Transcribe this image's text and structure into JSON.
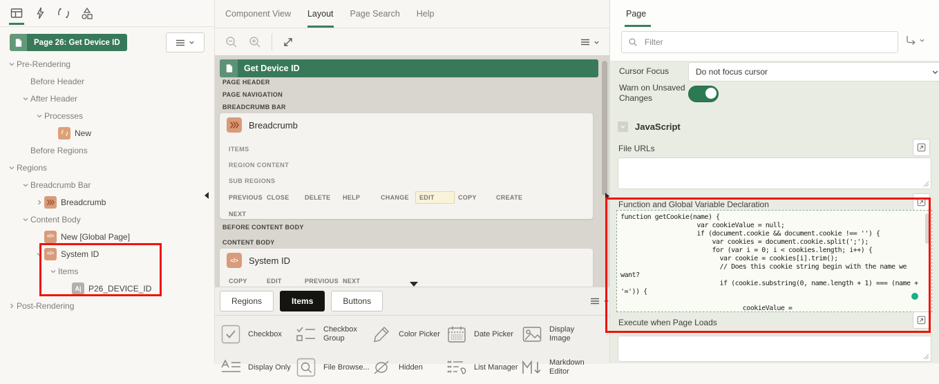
{
  "colors": {
    "green": "#38795a",
    "orange_icon": "#d99b7a",
    "annotation_red": "#ee1409",
    "toggle_on_green": "#2c7a52",
    "status_dot_green": "#19b183"
  },
  "left": {
    "toolbar_icons": [
      "rendering",
      "dynamic-actions",
      "processing",
      "shared-components"
    ],
    "toolbar_selected": "rendering",
    "page_badge": "Page 26: Get Device ID",
    "tree": [
      {
        "label": "Pre-Rendering",
        "level": 0,
        "chevron": "down"
      },
      {
        "label": "Before Header",
        "level": 1
      },
      {
        "label": "After Header",
        "level": 1,
        "chevron": "down"
      },
      {
        "label": "Processes",
        "level": 2,
        "chevron": "down"
      },
      {
        "label": "New",
        "level": 3,
        "icon": "process"
      },
      {
        "label": "Before Regions",
        "level": 1
      },
      {
        "label": "Regions",
        "level": 0,
        "chevron": "down"
      },
      {
        "label": "Breadcrumb Bar",
        "level": 1,
        "chevron": "down"
      },
      {
        "label": "Breadcrumb",
        "level": 2,
        "chevron": "right",
        "icon": "breadcrumb"
      },
      {
        "label": "Content Body",
        "level": 1,
        "chevron": "down"
      },
      {
        "label": "New [Global Page]",
        "level": 2,
        "icon": "code"
      },
      {
        "label": "System ID",
        "level": 2,
        "chevron": "down",
        "icon": "code"
      },
      {
        "label": "Items",
        "level": 3,
        "chevron": "down"
      },
      {
        "label": "P26_DEVICE_ID",
        "level": 4,
        "icon": "text-item"
      },
      {
        "label": "Post-Rendering",
        "level": 0,
        "chevron": "right"
      }
    ]
  },
  "center": {
    "tabs": [
      {
        "label": "Component View"
      },
      {
        "label": "Layout",
        "active": true
      },
      {
        "label": "Page Search"
      },
      {
        "label": "Help"
      }
    ],
    "canvas": {
      "page_title": "Get Device ID",
      "top_slots": [
        "PAGE HEADER",
        "PAGE NAVIGATION",
        "BREADCRUMB BAR"
      ],
      "breadcrumb_region": {
        "title": "Breadcrumb",
        "slots": [
          "ITEMS",
          "REGION CONTENT",
          "SUB REGIONS"
        ],
        "actions_row1": [
          "PREVIOUS",
          "CLOSE",
          "DELETE",
          "HELP",
          "CHANGE",
          "EDIT",
          "COPY",
          "CREATE"
        ],
        "actions_row2": [
          "NEXT"
        ],
        "highlighted_action": "EDIT"
      },
      "mid_slots": [
        "BEFORE CONTENT BODY",
        "CONTENT BODY"
      ],
      "system_region": {
        "title": "System ID",
        "actions_row1": [
          "COPY",
          "EDIT",
          "PREVIOUS",
          "NEXT"
        ],
        "actions_row2": []
      }
    },
    "gallery": {
      "tabs": [
        {
          "label": "Regions"
        },
        {
          "label": "Items",
          "active": true
        },
        {
          "label": "Buttons"
        }
      ],
      "row1": [
        {
          "icon": "checkbox",
          "label": "Checkbox",
          "two_line": false
        },
        {
          "icon": "checkbox-group",
          "label": "Checkbox Group",
          "two_line": true
        },
        {
          "icon": "color-picker",
          "label": "Color Picker",
          "two_line": false
        },
        {
          "icon": "date-picker",
          "label": "Date Picker",
          "two_line": false
        },
        {
          "icon": "display-image",
          "label": "Display Image",
          "two_line": true
        }
      ],
      "row2": [
        {
          "icon": "display-only",
          "label": "Display Only",
          "two_line": false
        },
        {
          "icon": "file-browse",
          "label": "File Browse...",
          "two_line": false
        },
        {
          "icon": "hidden",
          "label": "Hidden",
          "two_line": false
        },
        {
          "icon": "list-manager",
          "label": "List Manager",
          "two_line": false
        },
        {
          "icon": "markdown-editor",
          "label": "Markdown Editor",
          "two_line": true
        }
      ]
    }
  },
  "right": {
    "tab": "Page",
    "filter_placeholder": "Filter",
    "cursor_focus_label": "Cursor Focus",
    "cursor_focus_value": "Do not focus cursor",
    "warn_label": "Warn on Unsaved Changes",
    "warn_on": true,
    "javascript_section": "JavaScript",
    "file_urls_label": "File URLs",
    "file_urls_value": "",
    "function_declaration_label": "Function and Global Variable Declaration",
    "function_declaration_lines": [
      "function getCookie(name) {",
      "                    var cookieValue = null;",
      "                    if (document.cookie && document.cookie !== '') {",
      "                        var cookies = document.cookie.split(';');",
      "                        for (var i = 0; i < cookies.length; i++) {",
      "                          var cookie = cookies[i].trim();",
      "                          // Does this cookie string begin with the name we",
      "want?",
      "                          if (cookie.substring(0, name.length + 1) === (name +",
      "'=')) {",
      "",
      "                                cookieValue ="
    ],
    "execute_page_load_label": "Execute when Page Loads",
    "execute_page_load_value": ""
  }
}
